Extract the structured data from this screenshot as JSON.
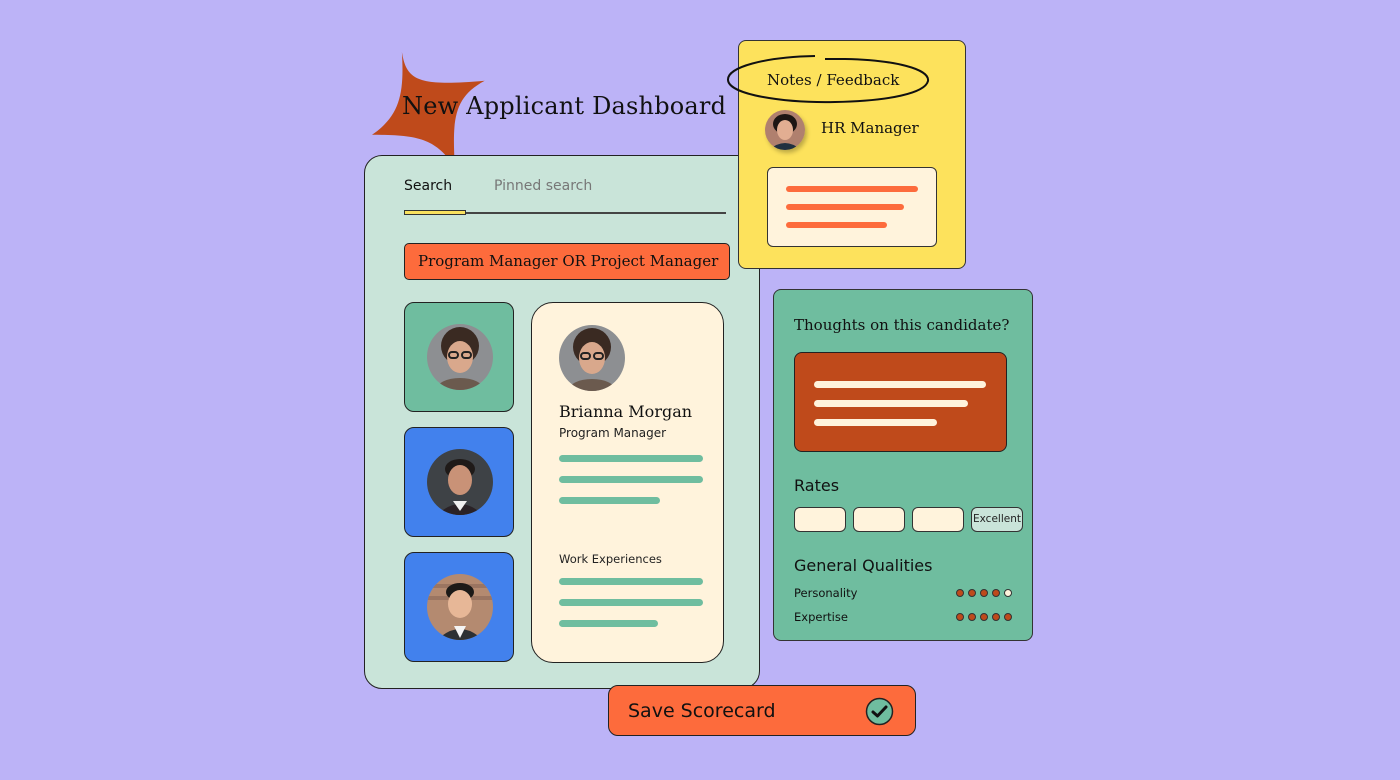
{
  "header": {
    "title": "New Applicant Dashboard"
  },
  "search_panel": {
    "tabs": [
      {
        "label": "Search",
        "active": true
      },
      {
        "label": "Pinned search",
        "active": false
      }
    ],
    "query": "Program Manager OR Project Manager",
    "candidates": [
      {
        "avatar": "woman-curly-hair-glasses",
        "card_color": "#6fbd9f"
      },
      {
        "avatar": "man-dark-hair",
        "card_color": "#4281ed"
      },
      {
        "avatar": "man-smiling-suit",
        "card_color": "#4281ed"
      }
    ],
    "selected_candidate": {
      "name": "Brianna Morgan",
      "role": "Program Manager",
      "work_experiences_label": "Work Experiences"
    }
  },
  "notes": {
    "title": "Notes / Feedback",
    "author": "HR Manager"
  },
  "thoughts": {
    "title": "Thoughts on this candidate?",
    "rates_title": "Rates",
    "rates": [
      "",
      "",
      "",
      "Excellent"
    ],
    "general_qualities_title": "General Qualities",
    "qualities": [
      {
        "label": "Personality",
        "score": 4,
        "max": 5
      },
      {
        "label": "Expertise",
        "score": 5,
        "max": 5
      }
    ]
  },
  "actions": {
    "save_label": "Save Scorecard",
    "save_icon": "check-circle-icon"
  },
  "colors": {
    "background": "#bcb3f7",
    "panel": "#c9e4d9",
    "green": "#6fbd9f",
    "blue": "#4281ed",
    "orange": "#fd6b3c",
    "rust": "#bf4a1b",
    "yellow": "#fde25c",
    "cream": "#fff3dc"
  }
}
